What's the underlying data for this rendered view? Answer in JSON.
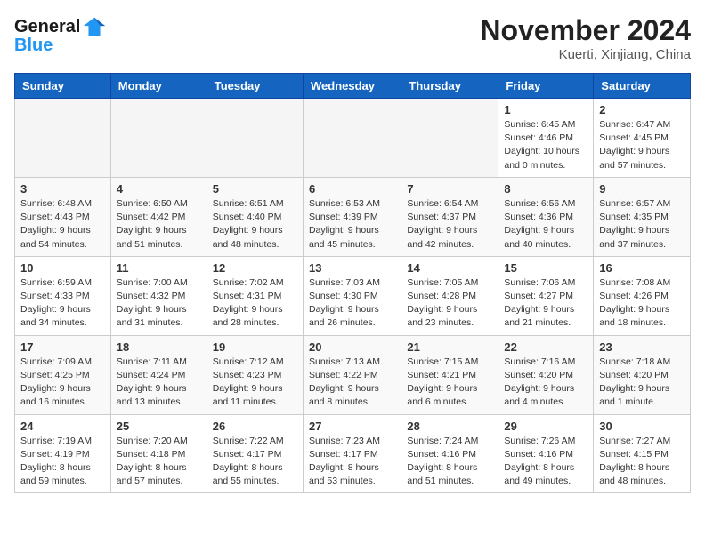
{
  "logo": {
    "line1": "General",
    "line2": "Blue"
  },
  "title": "November 2024",
  "location": "Kuerti, Xinjiang, China",
  "weekdays": [
    "Sunday",
    "Monday",
    "Tuesday",
    "Wednesday",
    "Thursday",
    "Friday",
    "Saturday"
  ],
  "weeks": [
    [
      {
        "day": "",
        "info": ""
      },
      {
        "day": "",
        "info": ""
      },
      {
        "day": "",
        "info": ""
      },
      {
        "day": "",
        "info": ""
      },
      {
        "day": "",
        "info": ""
      },
      {
        "day": "1",
        "info": "Sunrise: 6:45 AM\nSunset: 4:46 PM\nDaylight: 10 hours\nand 0 minutes."
      },
      {
        "day": "2",
        "info": "Sunrise: 6:47 AM\nSunset: 4:45 PM\nDaylight: 9 hours\nand 57 minutes."
      }
    ],
    [
      {
        "day": "3",
        "info": "Sunrise: 6:48 AM\nSunset: 4:43 PM\nDaylight: 9 hours\nand 54 minutes."
      },
      {
        "day": "4",
        "info": "Sunrise: 6:50 AM\nSunset: 4:42 PM\nDaylight: 9 hours\nand 51 minutes."
      },
      {
        "day": "5",
        "info": "Sunrise: 6:51 AM\nSunset: 4:40 PM\nDaylight: 9 hours\nand 48 minutes."
      },
      {
        "day": "6",
        "info": "Sunrise: 6:53 AM\nSunset: 4:39 PM\nDaylight: 9 hours\nand 45 minutes."
      },
      {
        "day": "7",
        "info": "Sunrise: 6:54 AM\nSunset: 4:37 PM\nDaylight: 9 hours\nand 42 minutes."
      },
      {
        "day": "8",
        "info": "Sunrise: 6:56 AM\nSunset: 4:36 PM\nDaylight: 9 hours\nand 40 minutes."
      },
      {
        "day": "9",
        "info": "Sunrise: 6:57 AM\nSunset: 4:35 PM\nDaylight: 9 hours\nand 37 minutes."
      }
    ],
    [
      {
        "day": "10",
        "info": "Sunrise: 6:59 AM\nSunset: 4:33 PM\nDaylight: 9 hours\nand 34 minutes."
      },
      {
        "day": "11",
        "info": "Sunrise: 7:00 AM\nSunset: 4:32 PM\nDaylight: 9 hours\nand 31 minutes."
      },
      {
        "day": "12",
        "info": "Sunrise: 7:02 AM\nSunset: 4:31 PM\nDaylight: 9 hours\nand 28 minutes."
      },
      {
        "day": "13",
        "info": "Sunrise: 7:03 AM\nSunset: 4:30 PM\nDaylight: 9 hours\nand 26 minutes."
      },
      {
        "day": "14",
        "info": "Sunrise: 7:05 AM\nSunset: 4:28 PM\nDaylight: 9 hours\nand 23 minutes."
      },
      {
        "day": "15",
        "info": "Sunrise: 7:06 AM\nSunset: 4:27 PM\nDaylight: 9 hours\nand 21 minutes."
      },
      {
        "day": "16",
        "info": "Sunrise: 7:08 AM\nSunset: 4:26 PM\nDaylight: 9 hours\nand 18 minutes."
      }
    ],
    [
      {
        "day": "17",
        "info": "Sunrise: 7:09 AM\nSunset: 4:25 PM\nDaylight: 9 hours\nand 16 minutes."
      },
      {
        "day": "18",
        "info": "Sunrise: 7:11 AM\nSunset: 4:24 PM\nDaylight: 9 hours\nand 13 minutes."
      },
      {
        "day": "19",
        "info": "Sunrise: 7:12 AM\nSunset: 4:23 PM\nDaylight: 9 hours\nand 11 minutes."
      },
      {
        "day": "20",
        "info": "Sunrise: 7:13 AM\nSunset: 4:22 PM\nDaylight: 9 hours\nand 8 minutes."
      },
      {
        "day": "21",
        "info": "Sunrise: 7:15 AM\nSunset: 4:21 PM\nDaylight: 9 hours\nand 6 minutes."
      },
      {
        "day": "22",
        "info": "Sunrise: 7:16 AM\nSunset: 4:20 PM\nDaylight: 9 hours\nand 4 minutes."
      },
      {
        "day": "23",
        "info": "Sunrise: 7:18 AM\nSunset: 4:20 PM\nDaylight: 9 hours\nand 1 minute."
      }
    ],
    [
      {
        "day": "24",
        "info": "Sunrise: 7:19 AM\nSunset: 4:19 PM\nDaylight: 8 hours\nand 59 minutes."
      },
      {
        "day": "25",
        "info": "Sunrise: 7:20 AM\nSunset: 4:18 PM\nDaylight: 8 hours\nand 57 minutes."
      },
      {
        "day": "26",
        "info": "Sunrise: 7:22 AM\nSunset: 4:17 PM\nDaylight: 8 hours\nand 55 minutes."
      },
      {
        "day": "27",
        "info": "Sunrise: 7:23 AM\nSunset: 4:17 PM\nDaylight: 8 hours\nand 53 minutes."
      },
      {
        "day": "28",
        "info": "Sunrise: 7:24 AM\nSunset: 4:16 PM\nDaylight: 8 hours\nand 51 minutes."
      },
      {
        "day": "29",
        "info": "Sunrise: 7:26 AM\nSunset: 4:16 PM\nDaylight: 8 hours\nand 49 minutes."
      },
      {
        "day": "30",
        "info": "Sunrise: 7:27 AM\nSunset: 4:15 PM\nDaylight: 8 hours\nand 48 minutes."
      }
    ]
  ]
}
